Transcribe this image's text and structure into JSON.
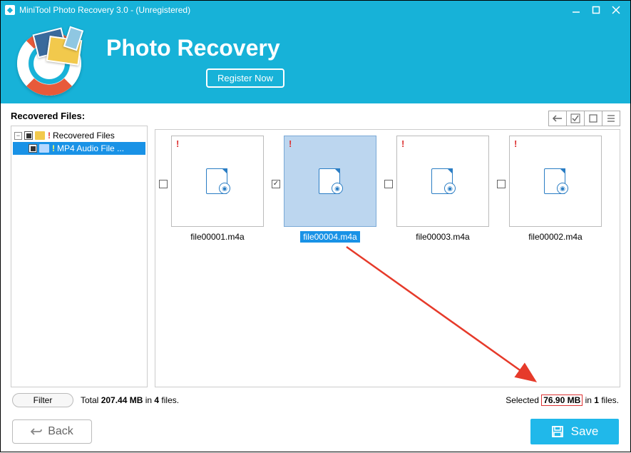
{
  "window": {
    "title": "MiniTool Photo Recovery 3.0 - (Unregistered)",
    "icons": {
      "min": "minimize-icon",
      "max": "maximize-icon",
      "close": "close-icon"
    }
  },
  "header": {
    "title": "Photo Recovery",
    "register_label": "Register Now"
  },
  "sidebar": {
    "label": "Recovered Files:",
    "root": {
      "label": "Recovered Files",
      "expanded": true
    },
    "child": {
      "label": "MP4 Audio File ..."
    }
  },
  "toolbar": {
    "back": "back",
    "checkall": "check-all",
    "viewlarge": "large-icons",
    "viewlist": "list"
  },
  "files": [
    {
      "name": "file00001.m4a",
      "selected": false,
      "checked": false
    },
    {
      "name": "file00004.m4a",
      "selected": true,
      "checked": true
    },
    {
      "name": "file00003.m4a",
      "selected": false,
      "checked": false
    },
    {
      "name": "file00002.m4a",
      "selected": false,
      "checked": false
    }
  ],
  "status": {
    "filter_label": "Filter",
    "total_prefix": "Total ",
    "total_size": "207.44 MB",
    "total_mid": " in ",
    "total_count": "4",
    "total_suffix": " files.",
    "selected_prefix": "Selected ",
    "selected_size": "76.90 MB",
    "selected_mid": " in ",
    "selected_count": "1",
    "selected_suffix": " files."
  },
  "buttons": {
    "back": "Back",
    "save": "Save"
  }
}
